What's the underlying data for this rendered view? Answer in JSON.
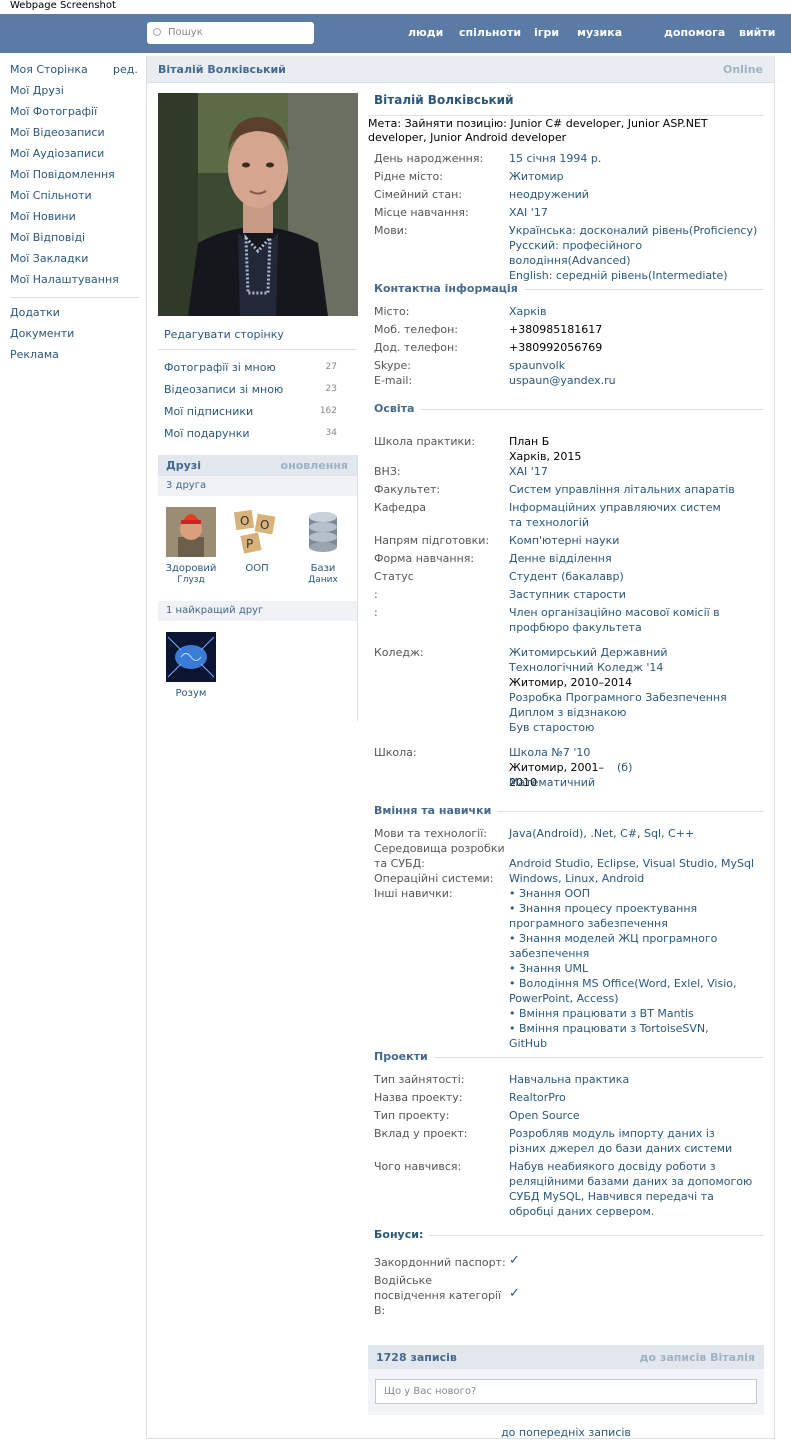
{
  "caption": "Webpage Screenshot",
  "topbar": {
    "search_placeholder": "Пошук",
    "nav": [
      "люди",
      "спільноти",
      "ігри",
      "музика",
      "допомога",
      "вийти"
    ]
  },
  "left_menu": {
    "edit_label": "ред.",
    "items": [
      "Моя Сторінка",
      "Мої Друзі",
      "Мої Фотографії",
      "Мої Відеозаписи",
      "Мої Аудіозаписи",
      "Мої Повідомлення",
      "Мої Спільноти",
      "Мої Новини",
      "Мої Відповіді",
      "Мої Закладки",
      "Мої Налаштування"
    ],
    "extra": [
      "Додатки",
      "Документи",
      "Реклама"
    ]
  },
  "header": {
    "name": "Віталій Волківський",
    "status": "Online"
  },
  "profile_left": {
    "edit_page": "Редагувати сторінку",
    "counters": [
      {
        "label": "Фотографії зі мною",
        "count": "27"
      },
      {
        "label": "Відеозаписи зі мною",
        "count": "23"
      },
      {
        "label": "Мої підписники",
        "count": "162"
      },
      {
        "label": "Мої подарунки",
        "count": "34"
      }
    ],
    "friends_title": "Друзі",
    "friends_updates": "оновлення",
    "friends_count": "3 друга",
    "friends": [
      {
        "name": "Здоровий",
        "sub": "Глузд"
      },
      {
        "name": "ООП",
        "sub": ""
      },
      {
        "name": "Бази",
        "sub": "Даних"
      }
    ],
    "best_friend_title": "1 найкращий друг",
    "best_friend": {
      "name": "Розум"
    }
  },
  "profile": {
    "name": "Віталій Волківський",
    "goal": "Мета: Зайняти позицію: Junior C# developer, Junior ASP.NET developer, Junior Android developer",
    "basic": [
      {
        "label": "День народження:",
        "value": "15 січня 1994 р."
      },
      {
        "label": "Рідне місто:",
        "value": "Житомир"
      },
      {
        "label": "Сімейний стан:",
        "value": "неодружений"
      },
      {
        "label": "Місце навчання:",
        "value": "ХАІ '17"
      },
      {
        "label": "Мови:",
        "value": "Українська: досконалий рівень(Proficiency)\nРусский: професійного володіння(Advanced)\nEnglish: середній рівень(Intermediate)"
      }
    ],
    "contacts_title": "Контактна інформація",
    "contacts": [
      {
        "label": "Місто:",
        "value": "Харків"
      },
      {
        "label": "Моб. телефон:",
        "value": "+380985181617"
      },
      {
        "label": "Дод. телефон:",
        "value": "+380992056769"
      },
      {
        "label": "Skype:",
        "value": "spaunvolk"
      },
      {
        "label": "E-mail:",
        "value": "uspaun@yandex.ru"
      }
    ],
    "education_title": "Освіта",
    "education": [
      {
        "label": "Школа практики:",
        "value": "План Б\nХарків, 2015"
      },
      {
        "label": "ВНЗ:",
        "value": "ХАІ '17"
      },
      {
        "label": "Факультет:",
        "value": "Систем управління літальних апаратів"
      },
      {
        "label": "Кафедра",
        "value": "Інформаційних управляючих систем та технологій"
      },
      {
        "label": "Напрям підготовки:",
        "value": "Комп'ютерні науки"
      },
      {
        "label": "Форма навчання:",
        "value": "Денне відділення"
      },
      {
        "label": "Статус",
        "value": "Студент (бакалавр)"
      },
      {
        "label": ":",
        "value": "Заступник старости"
      },
      {
        "label": ":",
        "value": "Член організаційно масової комісії в профбюро факультета"
      },
      {
        "label": "Коледж:",
        "value": "Житомирський Державний Технологічний Коледж '14"
      },
      {
        "label": "",
        "value": "Житомир, 2010–2014"
      },
      {
        "label": "",
        "value": "Розробка Програмного Забезпечення\nДиплом з відзнакою\nБув старостою"
      },
      {
        "label": "Школа:",
        "value": "Школа №7 '10"
      },
      {
        "label": "",
        "value": "Житомир, 2001–2010"
      },
      {
        "label": "",
        "value": "(б)"
      },
      {
        "label": "",
        "value": "Математичний"
      }
    ],
    "skills_title": "Вміння та навички",
    "skills": [
      {
        "label": "Мови та технології:",
        "value": "Java(Android), .Net, C#, Sql, C++"
      },
      {
        "label": "Середовища розробки та СУБД:",
        "value": "Android Studio, Eclipse, Visual Studio, MySql"
      },
      {
        "label": "Операційні системи:",
        "value": "Windows, Linux, Android"
      },
      {
        "label": "Інші навички:",
        "value": "• Знання ООП\n• Знання процесу проектування програмного забезпечення\n• Знання моделей ЖЦ програмного забезпечення\n• Знання UML\n• Володіння MS Office(Word, Exlel, Visio, PowerPoint, Access)\n• Вміння працювати з BT Mantis\n• Вміння працювати з TortoiseSVN, GitHub"
      }
    ],
    "projects_title": "Проекти",
    "projects": [
      {
        "label": "Тип зайнятості:",
        "value": "Навчальна практика"
      },
      {
        "label": "Назва проекту:",
        "value": "RealtorPro"
      },
      {
        "label": "Тип проекту:",
        "value": "Open Source"
      },
      {
        "label": "Вклад у проект:",
        "value": "Розробляв модуль імпорту даних із різних джерел до бази даних системи"
      },
      {
        "label": "Чого навчився:",
        "value": "Набув неабиякого досвіду роботи з реляційними базами даних за допомогою СУБД MySQL, Навчився передачі та обробці даних сервером."
      }
    ],
    "bonus_title": "Бонуси:",
    "bonuses": [
      {
        "label": "Закордонний паспорт:",
        "value": "✓"
      },
      {
        "label": "Водійське посвідчення категорії В:",
        "value": "✓"
      }
    ]
  },
  "wall": {
    "count_label": "1728 записів",
    "to_posts": "до записів Віталія",
    "input_placeholder": "Що у Вас нового?",
    "older_posts": "до попередніх записів"
  }
}
